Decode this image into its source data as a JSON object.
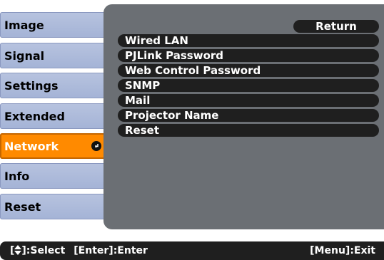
{
  "sidebar": {
    "items": [
      {
        "label": "Image",
        "active": false
      },
      {
        "label": "Signal",
        "active": false
      },
      {
        "label": "Settings",
        "active": false
      },
      {
        "label": "Extended",
        "active": false
      },
      {
        "label": "Network",
        "active": true
      },
      {
        "label": "Info",
        "active": false
      },
      {
        "label": "Reset",
        "active": false
      }
    ]
  },
  "panel": {
    "return_label": "Return",
    "items": [
      "Wired LAN",
      "PJLink Password",
      "Web Control Password",
      "SNMP",
      "Mail",
      "Projector Name",
      "Reset"
    ]
  },
  "status": {
    "select_text": "]:Select",
    "enter_text": "[Enter]:Enter",
    "menu_text": "[Menu]:Exit"
  },
  "colors": {
    "active_item": "#ff8a00",
    "panel_bg": "#6b6f74",
    "menu_row": "#1f1f1f",
    "sidebar_item": "#b7c3df"
  },
  "icons": {
    "enter": "enter-icon",
    "up_down": "up-down-arrow-icon"
  }
}
